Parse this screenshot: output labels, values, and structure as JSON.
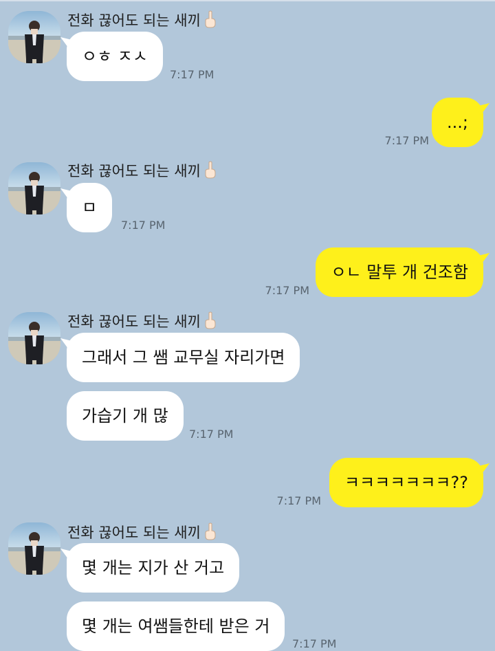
{
  "chat": {
    "messages": [
      {
        "sender": "전화 끊어도 되는 새끼",
        "text": "ㅇㅎ ㅈㅅ",
        "time": "7:17 PM"
      },
      {
        "text": "...;",
        "time": "7:17 PM"
      },
      {
        "sender": "전화 끊어도 되는 새끼",
        "text": "ㅁ",
        "time": "7:17 PM"
      },
      {
        "text": "ㅇㄴ 말투 개 건조함",
        "time": "7:17 PM"
      },
      {
        "sender": "전화 끊어도 되는 새끼",
        "text": "그래서 그 쌤 교무실 자리가면"
      },
      {
        "text": "가습기 개 많",
        "time": "7:17 PM"
      },
      {
        "text": "ㅋㅋㅋㅋㅋㅋㅋ??",
        "time": "7:17 PM"
      },
      {
        "sender": "전화 끊어도 되는 새끼",
        "text": "몇 개는 지가 산 거고"
      },
      {
        "text": "몇 개는 여쌤들한테 받은 거",
        "time": "7:17 PM"
      }
    ]
  },
  "colors": {
    "background": "#b2c7da",
    "incoming_bubble": "#ffffff",
    "outgoing_bubble": "#fef01b",
    "timestamp": "#58646f"
  },
  "icons": {
    "sender_emoji": "middle-finger-hand-icon",
    "avatar": "profile-photo-person-in-suit"
  }
}
